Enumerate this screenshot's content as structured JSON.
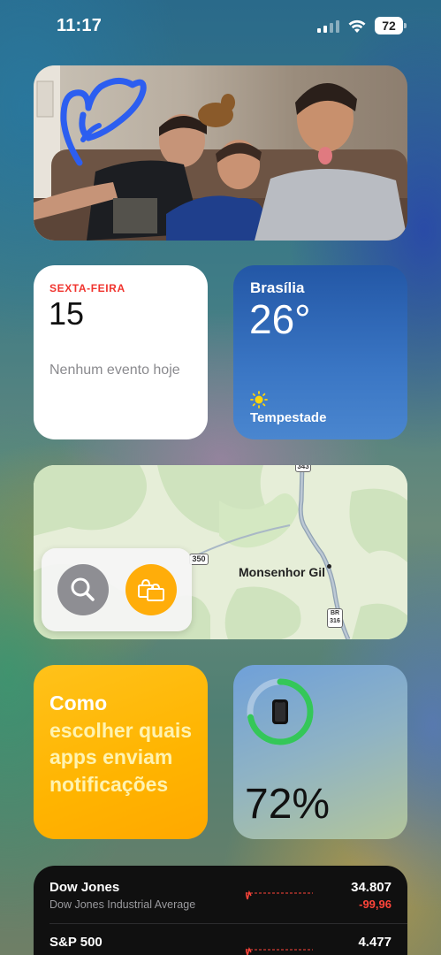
{
  "status_bar": {
    "time": "11:17",
    "battery_level": "72",
    "signal_bars_active": 2,
    "signal_bars_total": 4,
    "icons": [
      "cellular-signal-icon",
      "wifi-icon",
      "battery-icon"
    ]
  },
  "photo_widget": {
    "drawing_color": "#2c5ef0"
  },
  "calendar": {
    "weekday": "SEXTA-FEIRA",
    "date": "15",
    "events_text": "Nenhum evento hoje",
    "weekday_color": "#f0342e"
  },
  "weather": {
    "city": "Brasília",
    "temperature": "26°",
    "condition": "Tempestade",
    "icon": "sun-icon"
  },
  "map": {
    "place": "Monsenhor Gil",
    "road_labels": [
      "343",
      "350",
      "BR 316"
    ],
    "actions": [
      {
        "name": "search",
        "icon": "magnifying-glass-icon",
        "color": "#8e8e93"
      },
      {
        "name": "shopping",
        "icon": "shopping-bag-icon",
        "color": "#ffad0a"
      }
    ]
  },
  "tips": {
    "accent_text": "Como",
    "body_text": "escolher quais apps enviam notificações"
  },
  "battery_widget": {
    "level_percent": 72,
    "label": "72%",
    "icon": "iphone-icon",
    "ring_color": "#34c759"
  },
  "stocks": {
    "items": [
      {
        "symbol": "Dow Jones",
        "name": "Dow Jones Industrial Average",
        "price": "34.807",
        "change": "-99,96"
      },
      {
        "symbol": "S&P 500",
        "name": "",
        "price": "4.477",
        "change": ""
      }
    ],
    "negative_color": "#ff453a"
  }
}
